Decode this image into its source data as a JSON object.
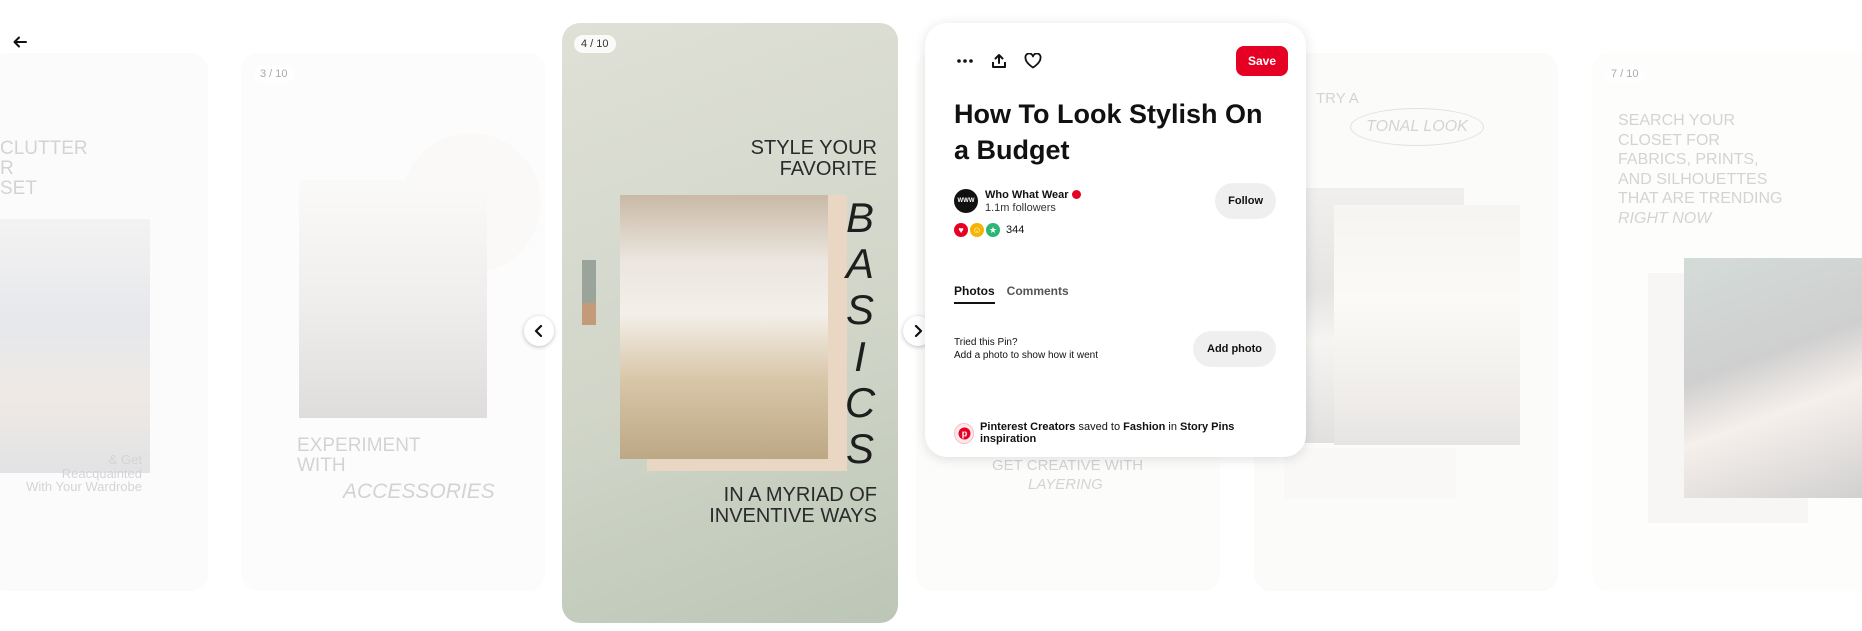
{
  "nav": {
    "back_icon": "arrow-left-icon"
  },
  "cards": [
    {
      "badge": "",
      "lines": [
        "CLUTTER",
        "R",
        "SET"
      ],
      "caption": "& Get Reacquainted\nWith Your Wardrobe"
    },
    {
      "badge": "3 / 10",
      "lines": [
        "EXPERIMENT",
        "WITH"
      ],
      "accent": "ACCESSORIES"
    },
    {
      "badge": "4 / 10",
      "top_text": [
        "STYLE YOUR",
        "FAVORITE"
      ],
      "vertical_word": "BASICS",
      "bottom_text": [
        "IN A MYRIAD OF",
        "INVENTIVE WAYS"
      ]
    },
    {
      "badge": "",
      "lines": [
        "GET CREATIVE WITH"
      ],
      "accent": "LAYERING"
    },
    {
      "badge": "",
      "lines": [
        "TRY A"
      ],
      "accent": "TONAL LOOK"
    },
    {
      "badge": "7 / 10",
      "lines": [
        "SEARCH YOUR",
        "CLOSET FOR",
        "FABRICS, PRINTS,",
        "AND SILHOUETTES",
        "THAT ARE TRENDING"
      ],
      "accent": "RIGHT NOW"
    }
  ],
  "panel": {
    "more_icon": "more-options-icon",
    "share_icon": "share-icon",
    "like_icon": "heart-icon",
    "save_label": "Save",
    "title": "How To Look Stylish On a Budget",
    "creator": {
      "avatar_text": "WWW",
      "name": "Who What Wear",
      "followers": "1.1m followers",
      "follow_label": "Follow"
    },
    "reactions": {
      "count": "344"
    },
    "tabs": [
      "Photos",
      "Comments"
    ],
    "tried": {
      "line1": "Tried this Pin?",
      "line2": "Add a photo to show how it went",
      "button": "Add photo"
    },
    "saved": {
      "who": "Pinterest Creators",
      "saved_to": "saved to",
      "board": "Fashion",
      "in": "in",
      "section": "Story Pins inspiration"
    }
  },
  "colors": {
    "brand_red": "#e60023"
  }
}
